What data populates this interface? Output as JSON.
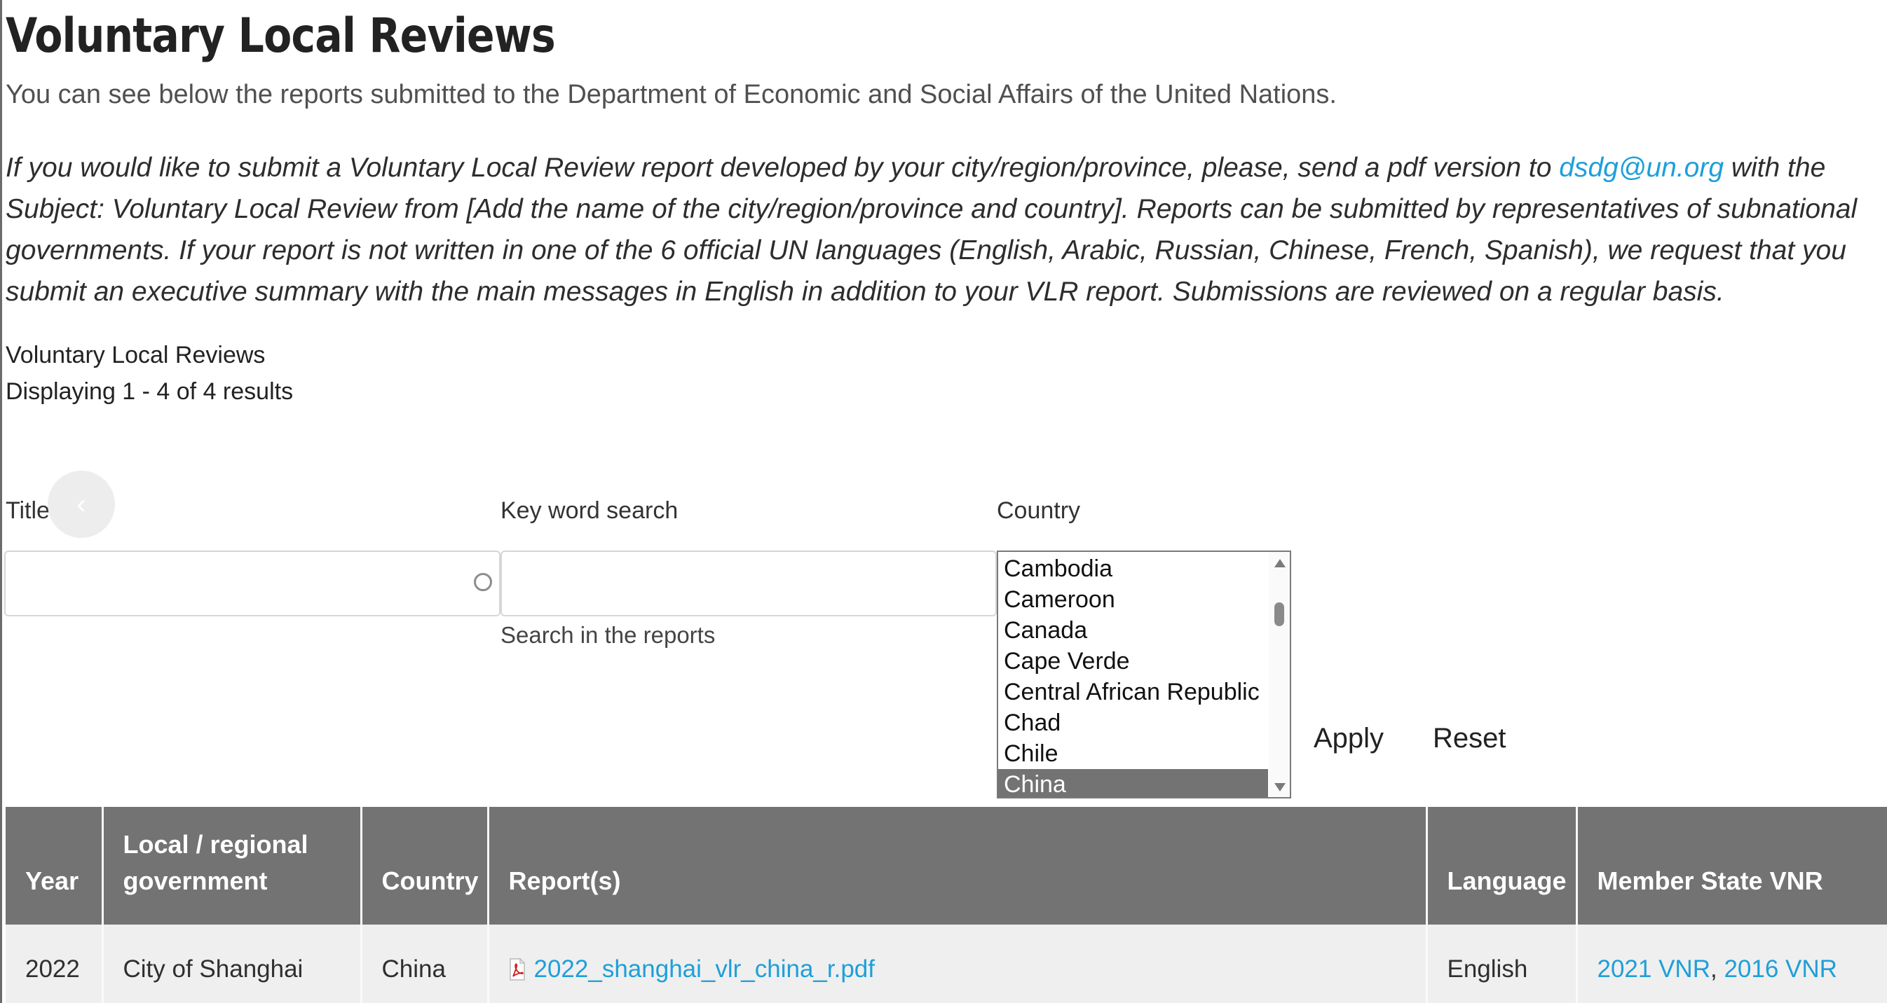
{
  "header": {
    "title": "Voluntary Local Reviews",
    "intro": "You can see below the reports submitted to the Department of Economic and Social Affairs of the United Nations."
  },
  "notice": {
    "before_link": "If you would like to submit a Voluntary Local Review report developed by your city/region/province, please, send a pdf version to ",
    "link_text": "dsdg@un.org",
    "after_link": " with the Subject: Voluntary Local Review from [Add the name of the city/region/province and country]. Reports can be submitted by representatives of subnational governments. If your report is not written in one of the 6 official UN languages (English, Arabic, Russian, Chinese, French, Spanish), we request that you submit an executive summary with the main messages in English in addition to your VLR report. Submissions are reviewed on a regular basis."
  },
  "view": {
    "title": "Voluntary Local Reviews",
    "summary": "Displaying 1 - 4 of 4 results"
  },
  "filters": {
    "title_label": "Title",
    "title_value": "",
    "keyword_label": "Key word search",
    "keyword_value": "",
    "keyword_description": "Search in the reports",
    "country_label": "Country",
    "country_options": [
      "Cambodia",
      "Cameroon",
      "Canada",
      "Cape Verde",
      "Central African Republic",
      "Chad",
      "Chile",
      "China"
    ],
    "country_selected": "China",
    "apply_label": "Apply",
    "reset_label": "Reset"
  },
  "table": {
    "headers": {
      "year": "Year",
      "government": "Local / regional government",
      "country": "Country",
      "reports": "Report(s)",
      "language": "Language",
      "vnr": "Member State VNR"
    },
    "rows": [
      {
        "year": "2022",
        "government": "City of Shanghai",
        "country": "China",
        "report": "2022_shanghai_vlr_china_r.pdf",
        "language": "English",
        "vnr_links": [
          "2021 VNR",
          "2016 VNR"
        ],
        "vnr_separator": ", "
      }
    ]
  },
  "icons": {
    "pdf": "pdf-file-icon",
    "back": "chevron-left-icon",
    "throbber": "loading-ring-icon"
  },
  "colors": {
    "link": "#1e9fd8",
    "table_header": "#737373",
    "row_background": "#efefef",
    "selected_option": "#737373"
  }
}
